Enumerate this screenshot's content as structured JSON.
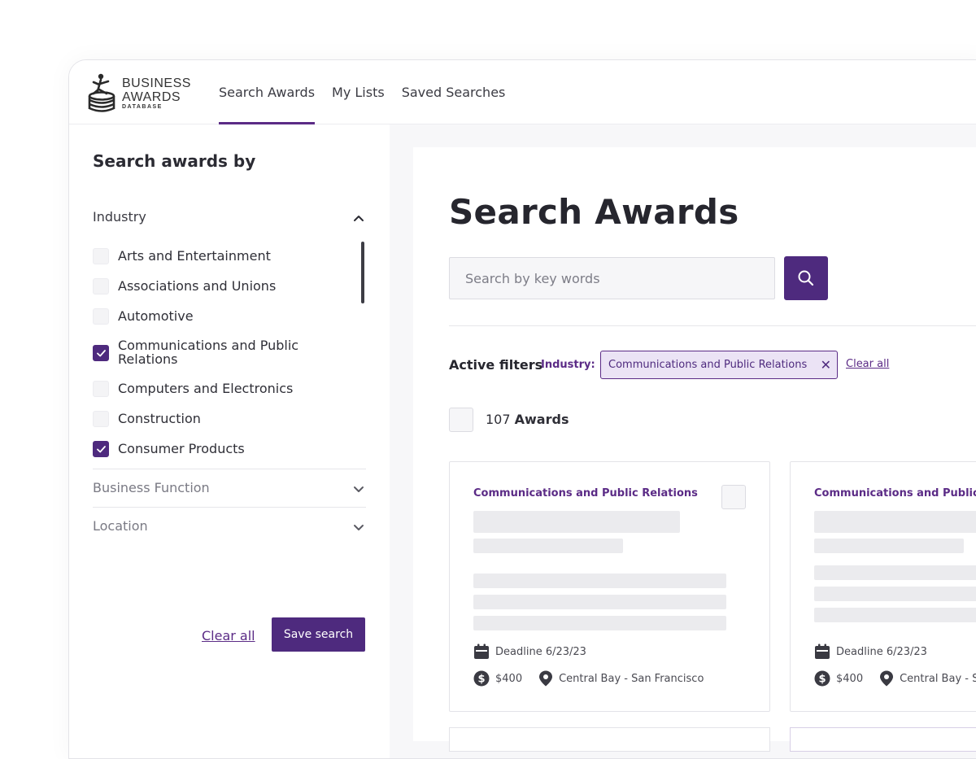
{
  "logo": {
    "line1": "BUSINESS",
    "line2": "AWARDS",
    "line3": "DATABASE"
  },
  "nav": {
    "items": [
      "Search Awards",
      "My Lists",
      "Saved Searches"
    ]
  },
  "sidebar": {
    "title": "Search awards by",
    "industry": {
      "label": "Industry",
      "options": [
        {
          "label": "Arts and Entertainment",
          "checked": false
        },
        {
          "label": "Associations and Unions",
          "checked": false
        },
        {
          "label": "Automotive",
          "checked": false
        },
        {
          "label": "Communications and Public Relations",
          "checked": true
        },
        {
          "label": "Computers and Electronics",
          "checked": false
        },
        {
          "label": "Construction",
          "checked": false
        },
        {
          "label": "Consumer Products",
          "checked": true
        }
      ]
    },
    "business_function": {
      "label": "Business Function"
    },
    "location": {
      "label": "Location"
    },
    "clear_label": "Clear all",
    "save_label": "Save search"
  },
  "main": {
    "title": "Search Awards",
    "search": {
      "placeholder": "Search by key words"
    },
    "active_filters": {
      "label": "Active filters",
      "industry_label": "Industry:",
      "chip": "Communications and Public Relations",
      "clear_label": "Clear all"
    },
    "count": {
      "number": "107",
      "label": "Awards"
    },
    "cards": [
      {
        "category": "Communications and Public Relations",
        "deadline": "Deadline 6/23/23",
        "price": "$400",
        "location": "Central Bay - San Francisco"
      },
      {
        "category": "Communications and Public Relations",
        "deadline": "Deadline 6/23/23",
        "price": "$400",
        "location": "Central Bay - San Francisco"
      }
    ]
  },
  "colors": {
    "accent": "#4e2a7e",
    "accent_text": "#5b2b86",
    "chip_bg": "#ebe3f5",
    "skeleton": "#ebebee"
  }
}
